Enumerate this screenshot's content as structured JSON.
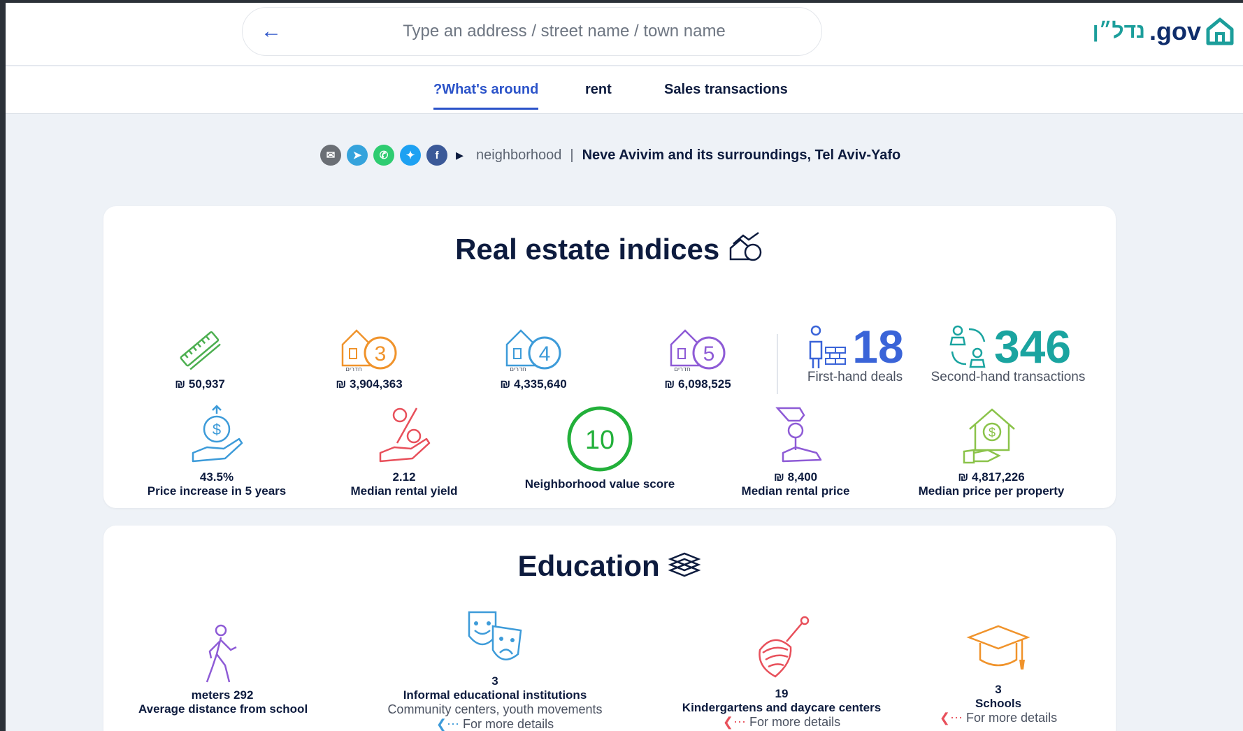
{
  "header": {
    "search_placeholder": "Type an address / street name / town name",
    "logo_gov": ".gov",
    "logo_heb": "נדל״ן"
  },
  "tabs": [
    {
      "label": "?What's around",
      "active": true
    },
    {
      "label": "rent",
      "active": false
    },
    {
      "label": "Sales transactions",
      "active": false
    }
  ],
  "breadcrumb": {
    "label": "neighborhood",
    "separator": "|",
    "value": "Neve Avivim and its surroundings, Tel Aviv-Yafo"
  },
  "share_icons": [
    "email-icon",
    "telegram-icon",
    "whatsapp-icon",
    "twitter-icon",
    "facebook-icon",
    "share-icon"
  ],
  "real_estate": {
    "title": "Real estate indices",
    "prices": [
      {
        "value": "₪ 50,937",
        "icon": "ruler-pencil-icon"
      },
      {
        "value": "₪ 3,904,363",
        "icon": "house-3-rooms-icon",
        "rooms": "3",
        "rooms_label": "חדרים"
      },
      {
        "value": "₪ 4,335,640",
        "icon": "house-4-rooms-icon",
        "rooms": "4",
        "rooms_label": "חדרים"
      },
      {
        "value": "₪ 6,098,525",
        "icon": "house-5-rooms-icon",
        "rooms": "5",
        "rooms_label": "חדרים"
      }
    ],
    "first_hand": {
      "count": "18",
      "label": "First-hand deals"
    },
    "second_hand": {
      "count": "346",
      "label": "Second-hand transactions"
    },
    "metrics": [
      {
        "value": "43.5%",
        "label": "Price increase in 5 years",
        "icon": "money-hand-icon"
      },
      {
        "value": "2.12",
        "label": "Median rental yield",
        "icon": "percent-hand-icon"
      },
      {
        "value": "10",
        "label": "Neighborhood value score",
        "icon": "score-circle-icon"
      },
      {
        "value": "₪ 8,400",
        "label": "Median rental price",
        "icon": "key-hand-icon"
      },
      {
        "value": "₪ 4,817,226",
        "label": "Median price per property",
        "icon": "house-money-icon"
      }
    ]
  },
  "education": {
    "title": "Education",
    "items": [
      {
        "value": "meters 292",
        "label": "Average distance from school",
        "icon": "walking-person-icon"
      },
      {
        "value": "3",
        "label": "Informal educational institutions",
        "sub": "Community centers, youth movements",
        "more": "For more details",
        "icon": "theater-masks-icon"
      },
      {
        "value": "19",
        "label": "Kindergartens and daycare centers",
        "more": "For more details",
        "icon": "spinning-top-icon"
      },
      {
        "value": "3",
        "label": "Schools",
        "more": "For more details",
        "icon": "graduation-cap-icon"
      }
    ]
  },
  "colors": {
    "accent": "#2b53c9",
    "teal": "#1c9e9b",
    "orange": "#f0932b",
    "blue": "#3d9bd9",
    "purple": "#8e5bd6",
    "green": "#4caf50",
    "red": "#e8505b",
    "first_hand": "#3a64d8",
    "second_hand": "#1aa4a0"
  }
}
